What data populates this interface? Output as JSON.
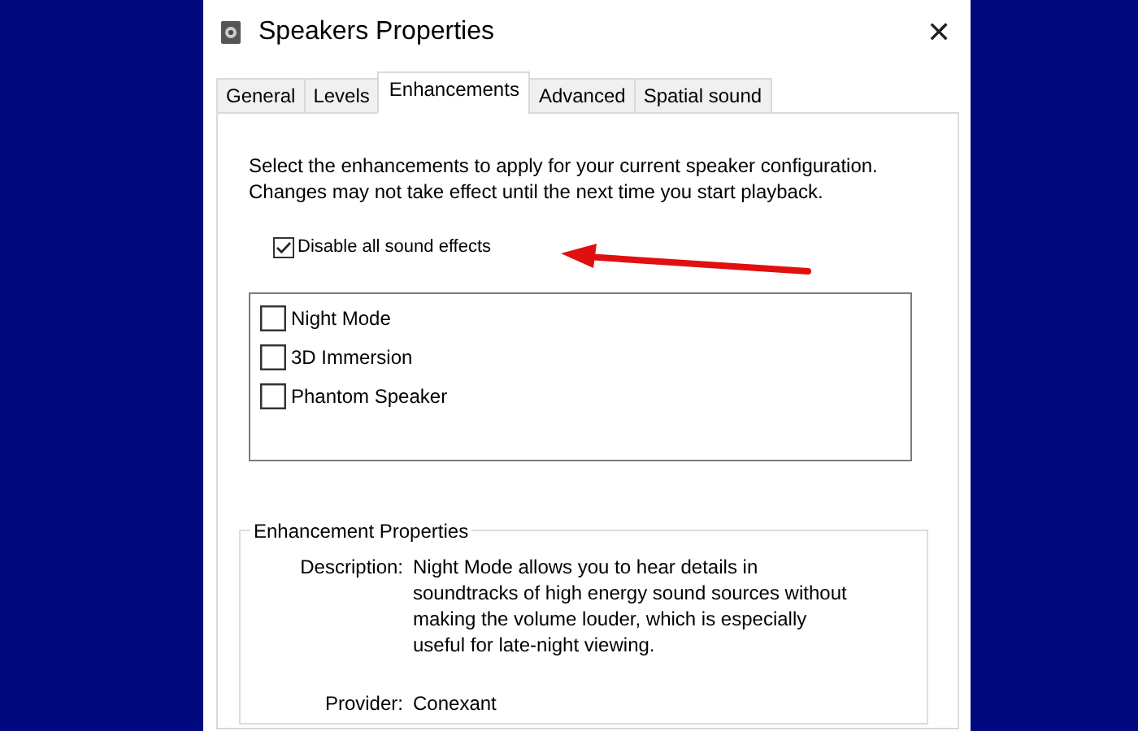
{
  "window": {
    "title": "Speakers Properties",
    "close": "✕"
  },
  "tabs": [
    {
      "label": "General",
      "selected": false
    },
    {
      "label": "Levels",
      "selected": false
    },
    {
      "label": "Enhancements",
      "selected": true
    },
    {
      "label": "Advanced",
      "selected": false
    },
    {
      "label": "Spatial sound",
      "selected": false
    }
  ],
  "intro": "Select the enhancements to apply for your current speaker configuration. Changes may not take effect until the next time you start playback.",
  "disable_all": {
    "label": "Disable all sound effects",
    "checked": true
  },
  "enhancements": [
    {
      "label": "Night Mode",
      "checked": false
    },
    {
      "label": "3D Immersion",
      "checked": false
    },
    {
      "label": "Phantom Speaker",
      "checked": false
    }
  ],
  "properties": {
    "title": "Enhancement Properties",
    "fields": [
      {
        "label": "Description:",
        "value": "Night Mode allows you to hear details in soundtracks of high energy sound sources without making the volume louder, which is especially useful for late-night viewing."
      },
      {
        "label": "Provider:",
        "value": "Conexant"
      }
    ]
  }
}
